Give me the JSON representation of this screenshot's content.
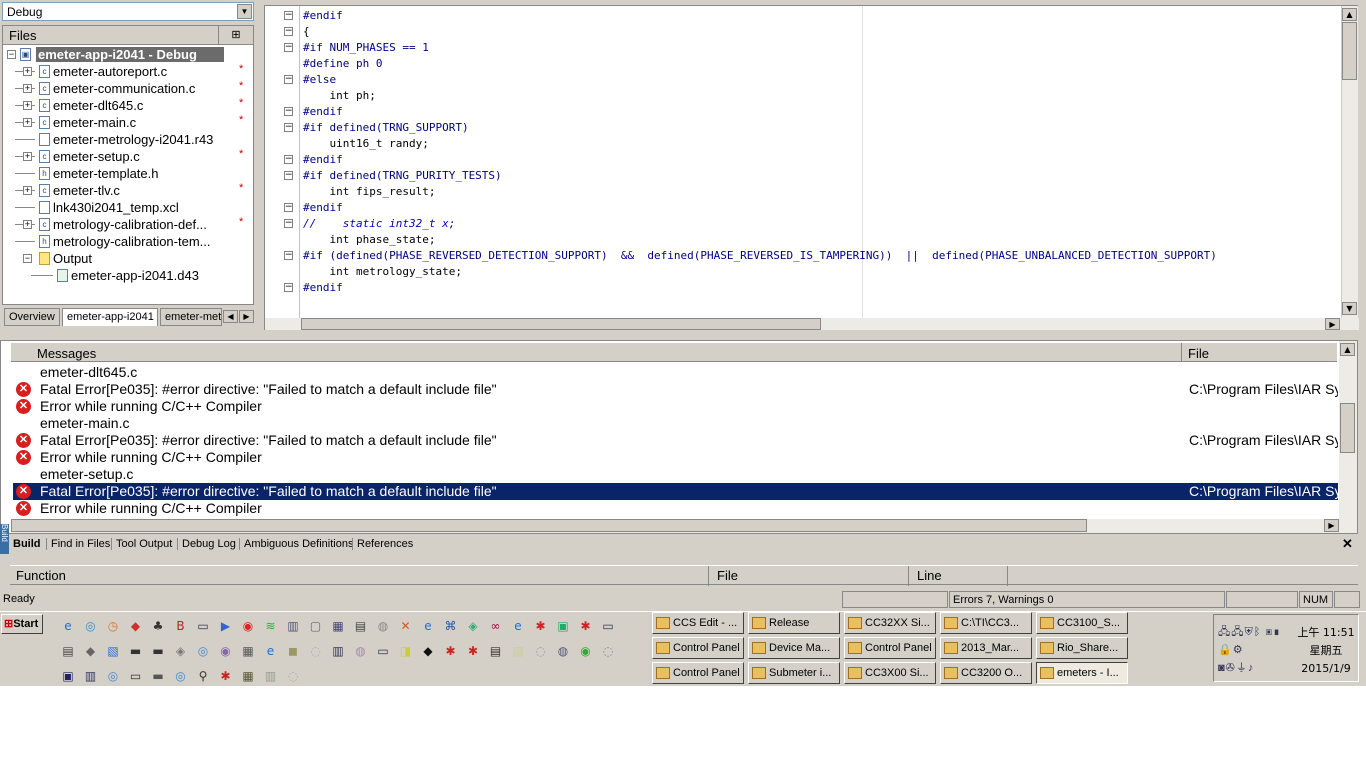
{
  "workspace": {
    "config": "Debug",
    "files_header": "Files",
    "root": "emeter-app-i2041 - Debug",
    "files": [
      {
        "name": "emeter-autoreport.c",
        "type": "c",
        "expandable": true,
        "dirty": true
      },
      {
        "name": "emeter-communication.c",
        "type": "c",
        "expandable": true,
        "dirty": true
      },
      {
        "name": "emeter-dlt645.c",
        "type": "c",
        "expandable": true,
        "dirty": true
      },
      {
        "name": "emeter-main.c",
        "type": "c",
        "expandable": true,
        "dirty": true
      },
      {
        "name": "emeter-metrology-i2041.r43",
        "type": "r",
        "expandable": false,
        "dirty": false
      },
      {
        "name": "emeter-setup.c",
        "type": "c",
        "expandable": true,
        "dirty": true
      },
      {
        "name": "emeter-template.h",
        "type": "h",
        "expandable": false,
        "dirty": false
      },
      {
        "name": "emeter-tlv.c",
        "type": "c",
        "expandable": true,
        "dirty": true
      },
      {
        "name": "lnk430i2041_temp.xcl",
        "type": "x",
        "expandable": false,
        "dirty": false
      },
      {
        "name": "metrology-calibration-def...",
        "type": "c",
        "expandable": true,
        "dirty": true
      },
      {
        "name": "metrology-calibration-tem...",
        "type": "h",
        "expandable": false,
        "dirty": false
      }
    ],
    "output_folder": "Output",
    "output_file": "emeter-app-i2041.d43",
    "dirty_mark": "*",
    "tabs": [
      "Overview",
      "emeter-app-i2041",
      "emeter-metr"
    ]
  },
  "editor": {
    "lines": [
      "#endif",
      "{",
      "#if NUM_PHASES == 1",
      "#define ph 0",
      "#else",
      "    int ph;",
      "#endif",
      "#if defined(TRNG_SUPPORT)",
      "    uint16_t randy;",
      "#endif",
      "#if defined(TRNG_PURITY_TESTS)",
      "    int fips_result;",
      "#endif",
      "//    static int32_t x;",
      "    int phase_state;",
      "#if (defined(PHASE_REVERSED_DETECTION_SUPPORT)  &&  defined(PHASE_REVERSED_IS_TAMPERING))  ||  defined(PHASE_UNBALANCED_DETECTION_SUPPORT)",
      "    int metrology_state;",
      "#endif"
    ]
  },
  "messages": {
    "col_messages": "Messages",
    "col_file": "File",
    "rows": [
      {
        "icon": false,
        "text": "emeter-dlt645.c",
        "file": "",
        "selected": false
      },
      {
        "icon": true,
        "text": "Fatal Error[Pe035]: #error directive: \"Failed to match a default include file\"",
        "file": "C:\\Program Files\\IAR Sys",
        "selected": false
      },
      {
        "icon": true,
        "text": "Error while running C/C++ Compiler",
        "file": "",
        "selected": false
      },
      {
        "icon": false,
        "text": "emeter-main.c",
        "file": "",
        "selected": false
      },
      {
        "icon": true,
        "text": "Fatal Error[Pe035]: #error directive: \"Failed to match a default include file\"",
        "file": "C:\\Program Files\\IAR Sys",
        "selected": false
      },
      {
        "icon": true,
        "text": "Error while running C/C++ Compiler",
        "file": "",
        "selected": false
      },
      {
        "icon": false,
        "text": "emeter-setup.c",
        "file": "",
        "selected": false
      },
      {
        "icon": true,
        "text": "Fatal Error[Pe035]: #error directive: \"Failed to match a default include file\"",
        "file": "C:\\Program Files\\IAR Sys",
        "selected": true
      },
      {
        "icon": true,
        "text": "Error while running C/C++ Compiler",
        "file": "",
        "selected": false
      }
    ],
    "tabs": [
      "Build",
      "Find in Files",
      "Tool Output",
      "Debug Log",
      "Ambiguous Definitions",
      "References"
    ],
    "side_label": "Build"
  },
  "function_pane": {
    "function": "Function",
    "file": "File",
    "line": "Line"
  },
  "status": {
    "ready": "Ready",
    "errors": "Errors 7, Warnings 0",
    "num": "NUM"
  },
  "taskbar": {
    "start": "Start",
    "tasks": [
      [
        "CCS Edit - ...",
        "Release",
        "CC32XX Si...",
        "C:\\TI\\CC3...",
        "CC3100_S..."
      ],
      [
        "Control Panel",
        "Device Ma...",
        "Control Panel",
        "2013_Mar...",
        "Rio_Share..."
      ],
      [
        "Control Panel",
        "Submeter i...",
        "CC3X00 Si...",
        "CC3200 O...",
        "emeters - I..."
      ]
    ],
    "clock_time": "上午 11:51",
    "clock_day": "星期五",
    "clock_date": "2015/1/9"
  }
}
